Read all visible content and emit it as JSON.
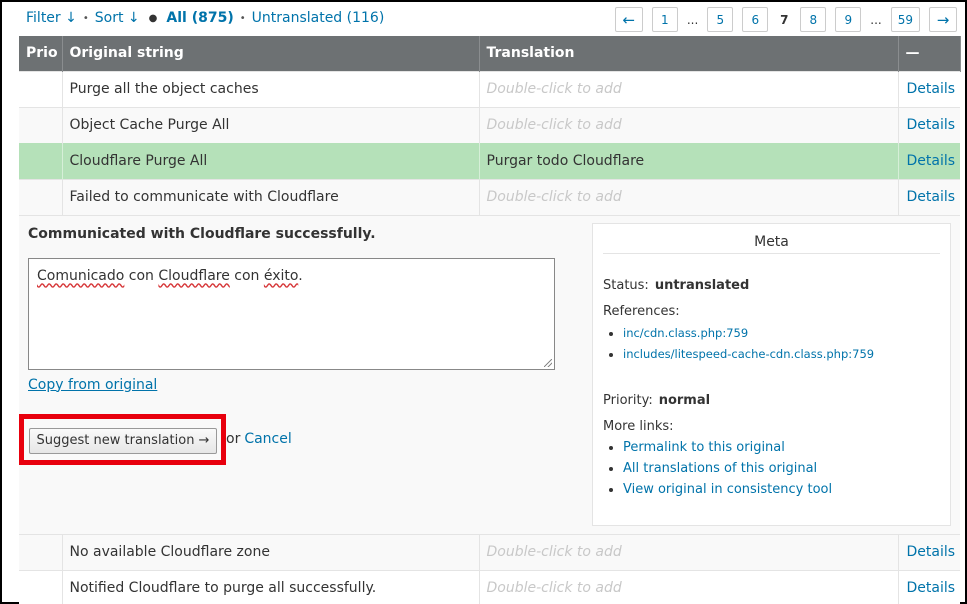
{
  "filter_bar": {
    "filter": "Filter ↓",
    "sort": "Sort ↓",
    "all": "All (875)",
    "untranslated": "Untranslated (116)"
  },
  "pagination": {
    "prev": "←",
    "first": "1",
    "ellipsis": "...",
    "pages": [
      "5",
      "6",
      "7",
      "8",
      "9"
    ],
    "current": "7",
    "last": "59",
    "next": "→"
  },
  "table": {
    "headers": {
      "prio": "Prio",
      "original": "Original string",
      "translation": "Translation",
      "actions": "—"
    },
    "rows_before": [
      {
        "original": "Purge all the object caches",
        "translation": "Double-click to add",
        "action": "Details"
      },
      {
        "original": "Object Cache Purge All",
        "translation": "Double-click to add",
        "action": "Details"
      },
      {
        "original": "Cloudflare Purge All",
        "translation": "Purgar todo Cloudflare",
        "action": "Details"
      },
      {
        "original": "Failed to communicate with Cloudflare",
        "translation": "Double-click to add",
        "action": "Details"
      }
    ],
    "rows_after": [
      {
        "original": "No available Cloudflare zone",
        "translation": "Double-click to add",
        "action": "Details"
      },
      {
        "original": "Notified Cloudflare to purge all successfully.",
        "translation": "Double-click to add",
        "action": "Details"
      }
    ]
  },
  "editor": {
    "source_text": "Communicated with Cloudflare successfully.",
    "translation_words": [
      "Comunicado",
      "con",
      "Cloudflare",
      "con",
      "éxito",
      "."
    ],
    "copy_link": "Copy from original",
    "suggest_button": "Suggest new translation →",
    "or_text": "or",
    "cancel_link": "Cancel"
  },
  "meta": {
    "title": "Meta",
    "status_label": "Status:",
    "status_value": "untranslated",
    "references_label": "References:",
    "references": [
      "inc/cdn.class.php:759",
      "includes/litespeed-cache-cdn.class.php:759"
    ],
    "priority_label": "Priority:",
    "priority_value": "normal",
    "more_links_label": "More links:",
    "more_links": [
      "Permalink to this original",
      "All translations of this original",
      "View original in consistency tool"
    ]
  },
  "colors": {
    "header_bg": "#6d7173",
    "link": "#0073aa",
    "approved_row": "#b5e1b9",
    "highlight_box": "#e8000d"
  }
}
